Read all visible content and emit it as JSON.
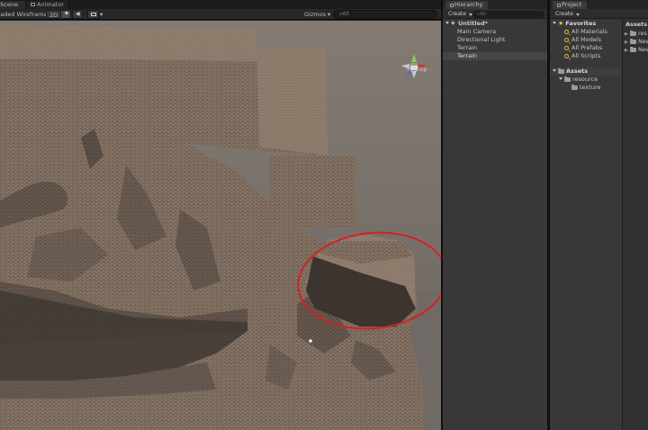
{
  "scene": {
    "tabs": [
      "Scene",
      "Animator"
    ],
    "toolbar": {
      "render_mode": "Shaded Wireframe",
      "mode_2d": "2D",
      "gizmos": "Gizmos",
      "search_placeholder": "All"
    },
    "persp_label": "Persp"
  },
  "hierarchy": {
    "tab_label": "Hierarchy",
    "create_label": "Create",
    "search_placeholder": "All",
    "scene_name": "Untitled*",
    "items": [
      {
        "label": "Main Camera",
        "selected": false
      },
      {
        "label": "Directional Light",
        "selected": false
      },
      {
        "label": "Terrain",
        "selected": false
      },
      {
        "label": "Terrain",
        "selected": true
      }
    ]
  },
  "project": {
    "tab_label": "Project",
    "create_label": "Create",
    "favorites_label": "Favorites",
    "favorites": [
      "All Materials",
      "All Models",
      "All Prefabs",
      "All Scripts"
    ],
    "assets_label": "Assets",
    "folders": [
      "resource",
      "texture"
    ],
    "right_header": "Assets",
    "right_items": [
      "res",
      "New",
      "New"
    ]
  },
  "colors": {
    "selection_circle": "#d62020",
    "terrain": "#8a7868",
    "sky": "#7a736c"
  }
}
